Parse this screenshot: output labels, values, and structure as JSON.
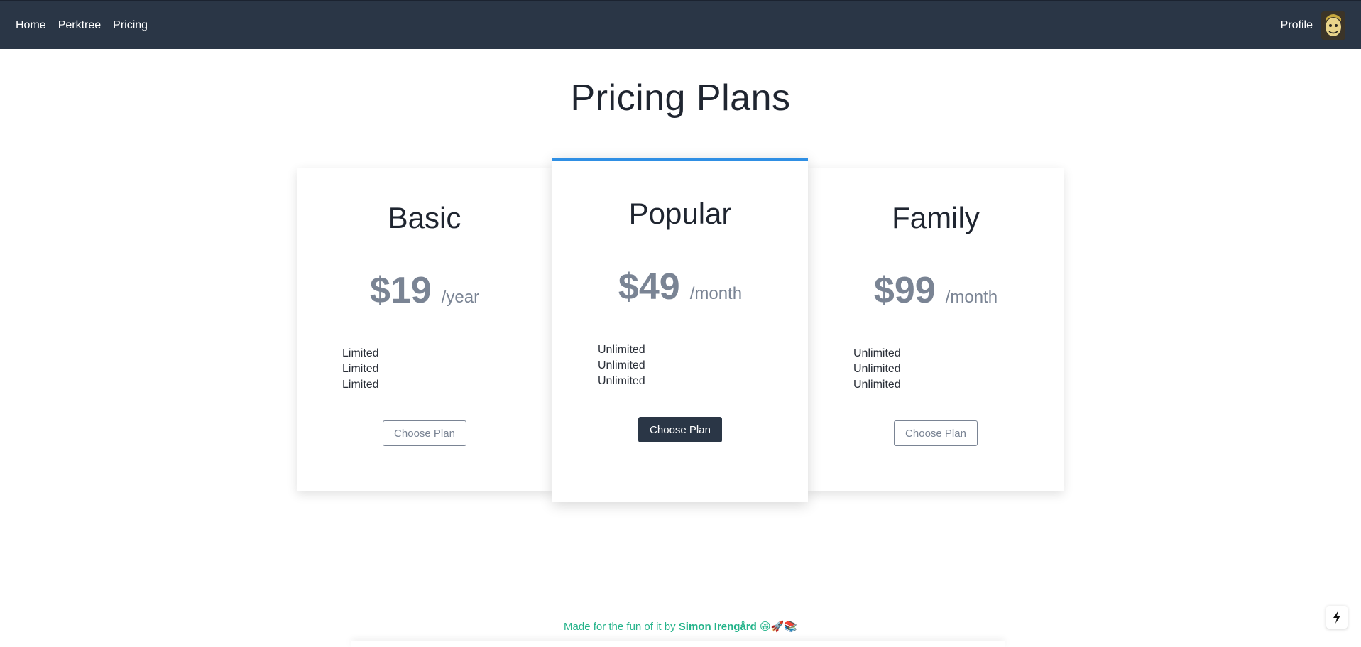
{
  "nav": {
    "links": [
      "Home",
      "Perktree",
      "Pricing"
    ],
    "profile_label": "Profile"
  },
  "page": {
    "title": "Pricing Plans"
  },
  "plans": [
    {
      "name": "Basic",
      "price": "$19",
      "period": "/year",
      "features": [
        "Limited",
        "Limited",
        "Limited"
      ],
      "button": "Choose Plan"
    },
    {
      "name": "Popular",
      "price": "$49",
      "period": "/month",
      "features": [
        "Unlimited",
        "Unlimited",
        "Unlimited"
      ],
      "button": "Choose Plan"
    },
    {
      "name": "Family",
      "price": "$99",
      "period": "/month",
      "features": [
        "Unlimited",
        "Unlimited",
        "Unlimited"
      ],
      "button": "Choose Plan"
    }
  ],
  "footer": {
    "prefix": "Made for the fun of it by",
    "author": "Simon Irengård",
    "emojis": "😁🚀📚"
  },
  "colors": {
    "navbar": "#2a3646",
    "accent": "#2f8fe4",
    "footer_text": "#24b38a",
    "muted": "#7a8494"
  },
  "icons": {
    "avatar": "avatar-icon",
    "corner": "lightning-icon"
  }
}
